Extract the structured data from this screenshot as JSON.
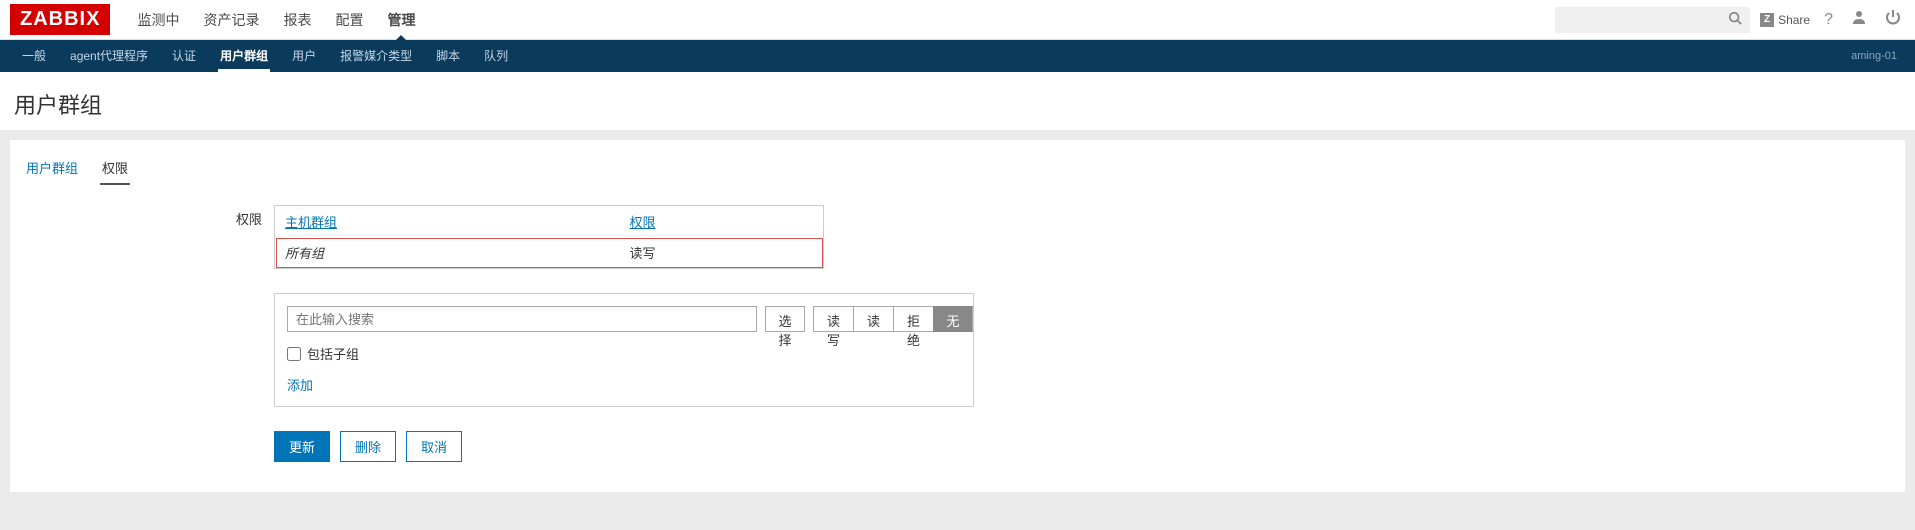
{
  "logo": "ZABBIX",
  "top_menu": {
    "items": [
      {
        "label": "监测中"
      },
      {
        "label": "资产记录"
      },
      {
        "label": "报表"
      },
      {
        "label": "配置"
      },
      {
        "label": "管理"
      }
    ]
  },
  "share": {
    "label": "Share"
  },
  "sub_menu": {
    "items": [
      {
        "label": "一般"
      },
      {
        "label": "agent代理程序"
      },
      {
        "label": "认证"
      },
      {
        "label": "用户群组"
      },
      {
        "label": "用户"
      },
      {
        "label": "报警媒介类型"
      },
      {
        "label": "脚本"
      },
      {
        "label": "队列"
      }
    ],
    "server": "aming-01"
  },
  "page": {
    "title": "用户群组"
  },
  "tabs": {
    "items": [
      {
        "label": "用户群组"
      },
      {
        "label": "权限"
      }
    ]
  },
  "form": {
    "perm_label": "权限",
    "table_headers": {
      "host_group": "主机群组",
      "permission": "权限"
    },
    "table_rows": [
      {
        "group": "所有组",
        "perm": "读写"
      }
    ],
    "search_placeholder": "在此输入搜索",
    "select_btn": "选择",
    "perm_buttons": {
      "rw": "读写",
      "r": "读",
      "deny": "拒绝",
      "none": "无"
    },
    "include_sub": "包括子组",
    "add_link": "添加"
  },
  "buttons": {
    "update": "更新",
    "delete": "删除",
    "cancel": "取消"
  }
}
